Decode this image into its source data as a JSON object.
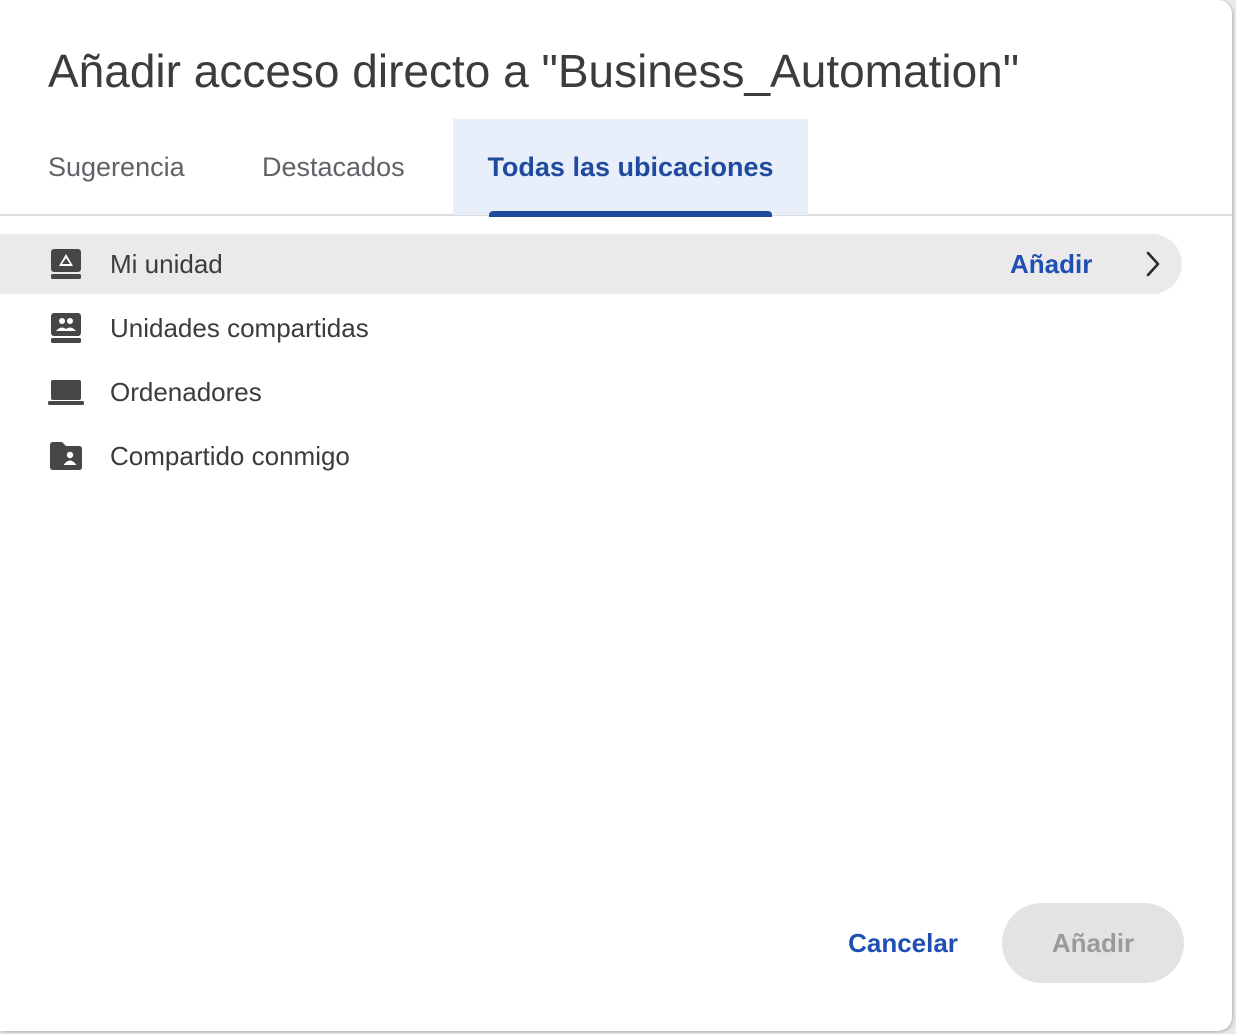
{
  "dialog": {
    "title": "Añadir acceso directo a \"Business_Automation\""
  },
  "tabs": [
    {
      "label": "Sugerencia",
      "active": false
    },
    {
      "label": "Destacados",
      "active": false
    },
    {
      "label": "Todas las ubicaciones",
      "active": true
    }
  ],
  "locations": [
    {
      "label": "Mi unidad",
      "icon": "my-drive-icon",
      "selected": true,
      "action_label": "Añadir"
    },
    {
      "label": "Unidades compartidas",
      "icon": "shared-drives-icon",
      "selected": false
    },
    {
      "label": "Ordenadores",
      "icon": "computers-icon",
      "selected": false
    },
    {
      "label": "Compartido conmigo",
      "icon": "shared-with-me-icon",
      "selected": false
    }
  ],
  "footer": {
    "cancel_label": "Cancelar",
    "add_label": "Añadir",
    "add_enabled": false
  },
  "colors": {
    "accent": "#1f4a9e",
    "link": "#1f4fb5",
    "active_tab_bg": "#e8effa",
    "selected_row_bg": "#eaeaea",
    "disabled_button_bg": "#e3e3e3"
  }
}
